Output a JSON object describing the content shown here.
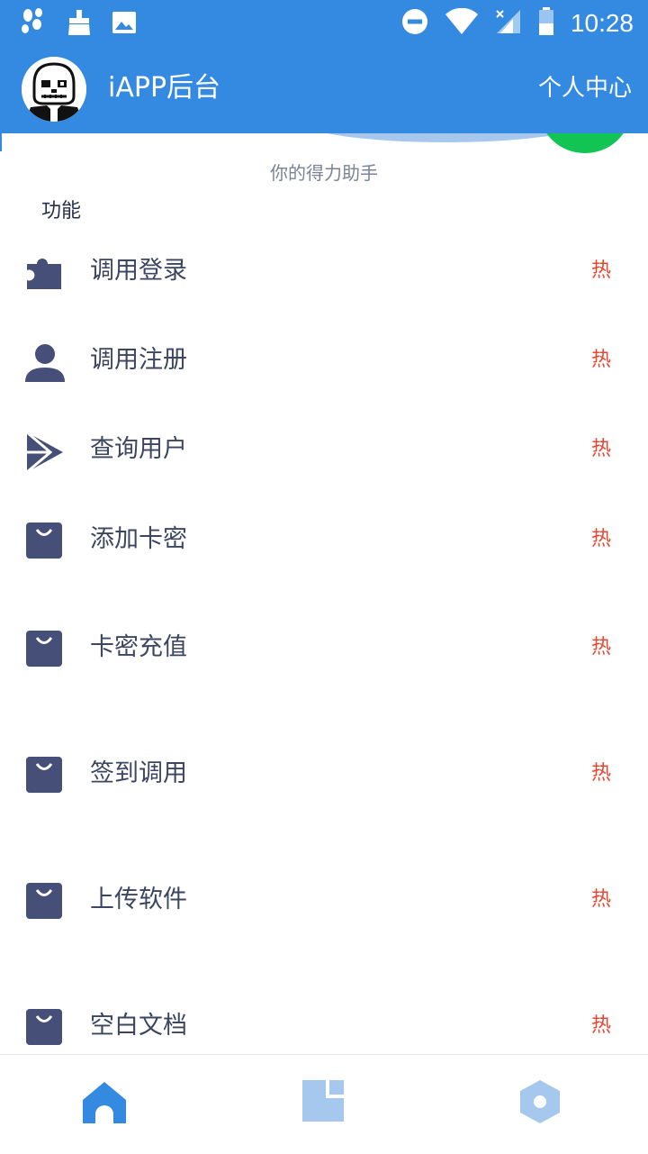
{
  "status_bar": {
    "time": "10:28"
  },
  "app_bar": {
    "title": "iAPP后台",
    "personal_center": "个人中心"
  },
  "tagline": "你的得力助手",
  "section_title": "功能",
  "items": [
    {
      "label": "调用登录",
      "badge": "热",
      "icon": "puzzle-icon"
    },
    {
      "label": "调用注册",
      "badge": "热",
      "icon": "user-icon"
    },
    {
      "label": "查询用户",
      "badge": "热",
      "icon": "play-store-icon"
    },
    {
      "label": "添加卡密",
      "badge": "热",
      "icon": "shopping-bag-icon"
    },
    {
      "label": "卡密充值",
      "badge": "热",
      "icon": "shopping-bag-icon"
    },
    {
      "label": "签到调用",
      "badge": "热",
      "icon": "shopping-bag-icon"
    },
    {
      "label": "上传软件",
      "badge": "热",
      "icon": "shopping-bag-icon"
    },
    {
      "label": "空白文档",
      "badge": "热",
      "icon": "shopping-bag-icon"
    }
  ],
  "bottom_nav": [
    {
      "icon": "home-icon",
      "active": true
    },
    {
      "icon": "document-icon",
      "active": false
    },
    {
      "icon": "settings-hexagon-icon",
      "active": false
    }
  ],
  "colors": {
    "primary": "#348ae0",
    "icon": "#454f78",
    "hot": "#e8442e",
    "accent_green": "#12c453"
  }
}
